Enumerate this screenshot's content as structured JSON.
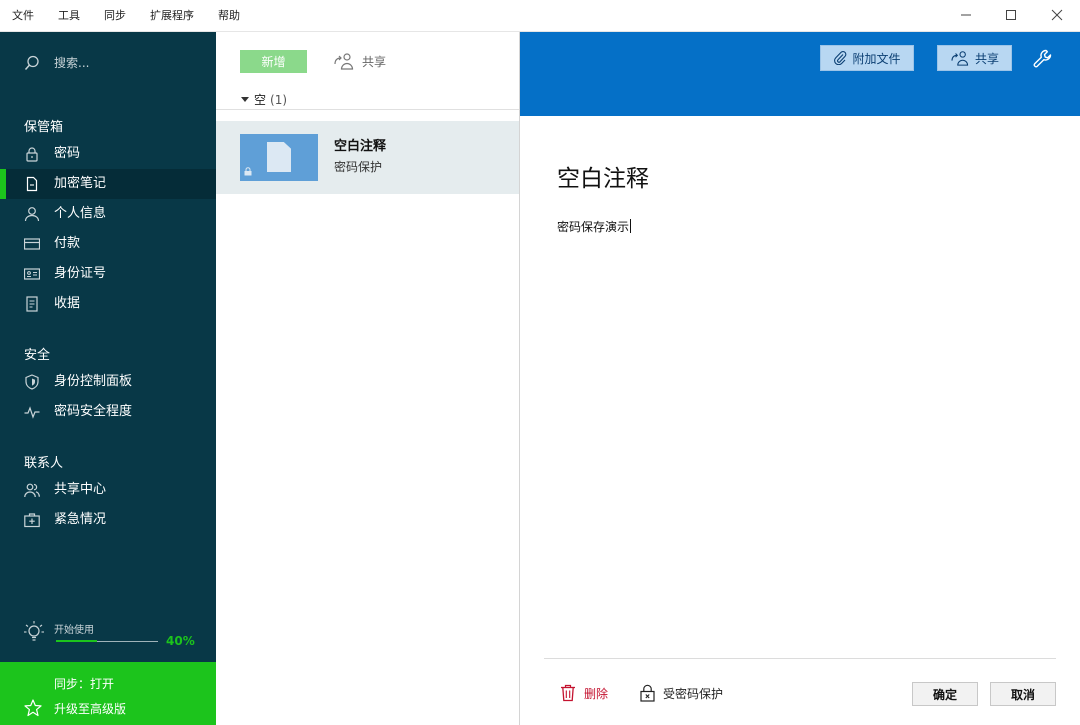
{
  "menubar": {
    "items": [
      "文件",
      "工具",
      "同步",
      "扩展程序",
      "帮助"
    ]
  },
  "sidebar": {
    "search_placeholder": "搜索...",
    "sections": [
      {
        "title": "保管箱",
        "items": [
          {
            "label": "密码",
            "icon": "lock-icon"
          },
          {
            "label": "加密笔记",
            "icon": "note-icon",
            "active": true
          },
          {
            "label": "个人信息",
            "icon": "person-icon"
          },
          {
            "label": "付款",
            "icon": "card-icon"
          },
          {
            "label": "身份证号",
            "icon": "id-card-icon"
          },
          {
            "label": "收据",
            "icon": "receipt-icon"
          }
        ]
      },
      {
        "title": "安全",
        "items": [
          {
            "label": "身份控制面板",
            "icon": "shield-icon"
          },
          {
            "label": "密码安全程度",
            "icon": "pulse-icon"
          }
        ]
      },
      {
        "title": "联系人",
        "items": [
          {
            "label": "共享中心",
            "icon": "people-icon"
          },
          {
            "label": "紧急情况",
            "icon": "emergency-icon"
          }
        ]
      }
    ],
    "getting_started": {
      "label": "开始使用",
      "percent_text": "40%",
      "progress": 0.4
    },
    "sync_status": "同步：打开",
    "upgrade_label": "升级至高级版"
  },
  "list": {
    "new_button": "新增",
    "share_button": "共享",
    "group_label": "空",
    "group_count": "(1)",
    "items": [
      {
        "title": "空白注释",
        "subtitle": "密码保护"
      }
    ]
  },
  "detail": {
    "attach_button": "附加文件",
    "share_button": "共享",
    "title": "空白注释",
    "body": "密码保存演示",
    "delete_label": "删除",
    "protect_label": "受密码保护",
    "ok_button": "确定",
    "cancel_button": "取消"
  },
  "colors": {
    "sidebar_bg": "#083847",
    "accent_green": "#1cc41c",
    "header_blue": "#0570c7",
    "delete_red": "#c4122f"
  }
}
